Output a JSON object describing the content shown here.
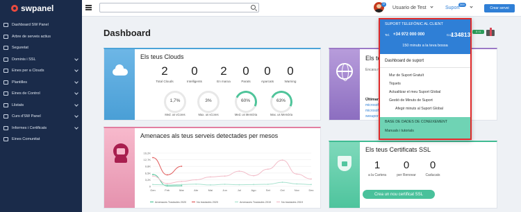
{
  "brand": {
    "name": "swpanel"
  },
  "sidebar": {
    "items": [
      {
        "label": "Dashboard SW Panel",
        "chevron": false
      },
      {
        "label": "Arbre de serveis actius",
        "chevron": false
      },
      {
        "label": "Seguretat",
        "chevron": false
      },
      {
        "label": "Dominis i SSL",
        "chevron": true
      },
      {
        "label": "Eines per a Clouds",
        "chevron": true
      },
      {
        "label": "Plantilles",
        "chevron": true
      },
      {
        "label": "Eines de Control",
        "chevron": true
      },
      {
        "label": "Llistats",
        "chevron": true
      },
      {
        "label": "Curs d'SW Panel",
        "chevron": true
      },
      {
        "label": "Informes i Certificats",
        "chevron": true
      },
      {
        "label": "Eines Comunitat",
        "chevron": false
      }
    ]
  },
  "topbar": {
    "search_placeholder": "",
    "user_name": "Usuario de Test",
    "user_badge": "0",
    "support_label": "Suport",
    "support_badge": "300",
    "create_button": "Crear servei"
  },
  "page_title": "Dashboard",
  "clouds": {
    "title": "Els teus Clouds",
    "stats": [
      {
        "value": "2",
        "label": "Total Clouds"
      },
      {
        "value": "0",
        "label": "Intelligents"
      },
      {
        "value": "2",
        "label": "En marxa"
      },
      {
        "value": "0",
        "label": "Parats"
      },
      {
        "value": "0",
        "label": "Aparcats"
      },
      {
        "value": "0",
        "label": "Warning"
      }
    ],
    "gauges": [
      {
        "value": "1,7%",
        "label": "Med. us vCores"
      },
      {
        "value": "3%",
        "label": "Max. us vCores"
      },
      {
        "value": "60%",
        "label": "Med. us Memòria"
      },
      {
        "value": "63%",
        "label": "Max. us Memòria"
      }
    ]
  },
  "threats": {
    "title": "Amenaces als teus serveis detectades per mesos"
  },
  "general": {
    "title": "Els te",
    "subtitle": "Encara n",
    "last_label": "Últimar",
    "domains": [
      "microsof",
      "microsof",
      "swsupor",
      "swsupor"
    ]
  },
  "ssl": {
    "title": "Els teus Certificats SSL",
    "stats": [
      {
        "value": "1",
        "label": "a la Cartera"
      },
      {
        "value": "0",
        "label": "per Renovar"
      },
      {
        "value": "0",
        "label": "Caducats"
      }
    ],
    "button": "Crea un nou certificat SSL"
  },
  "mini_flag": "0 / 0",
  "dropdown": {
    "header_title": "SUPORT TELEFÒNIC AL CLIENT",
    "tel_label": "Tel.",
    "tel": "+34 972 000 000",
    "code_label": "Codi",
    "code": "134813",
    "minutes": "150  minuts a la teva bossa",
    "section_title": "Dashboard de suport",
    "items": [
      "Mur de Suport Gratuït",
      "Tiquets",
      "Actualitzar el meu Suport Global",
      "Gestió de Minuts de Suport",
      "Afegir minuts al Suport Global"
    ],
    "kb_title": "BASE DE DADES DE CONEIXEMENT",
    "kb_item": "Manuals i tutorials"
  },
  "chart_data": {
    "type": "line",
    "title": "",
    "categories": [
      "Gen",
      "Feb",
      "Mar",
      "Abr",
      "Mai",
      "Jun",
      "Jul",
      "Ago",
      "Set",
      "Oct",
      "Nov",
      "Dec"
    ],
    "yticks": [
      "16,2K",
      "12,7K",
      "9,8K",
      "6,5K",
      "3,2K",
      "0"
    ],
    "ylim": [
      0,
      16200
    ],
    "series": [
      {
        "name": "Amenaces Tractades 2020",
        "color": "#4fc49a",
        "values": [
          5800,
          200,
          300,
          null,
          null,
          null,
          null,
          null,
          null,
          null,
          null,
          null
        ]
      },
      {
        "name": "No tractades 2020",
        "color": "#e05a5a",
        "values": [
          14000,
          5600,
          9800,
          null,
          null,
          null,
          null,
          null,
          null,
          null,
          null,
          null
        ]
      },
      {
        "name": "Amenaces Tractades 2019",
        "color": "#a9e2cf",
        "values": [
          900,
          700,
          900,
          1100,
          700,
          1000,
          800,
          900,
          1000,
          2000,
          1200,
          900
        ]
      },
      {
        "name": "No tractades 2019",
        "color": "#f2bcc8",
        "values": [
          5000,
          1400,
          2400,
          3200,
          4600,
          5000,
          7400,
          5200,
          8400,
          12800,
          6000,
          3600
        ]
      }
    ]
  }
}
